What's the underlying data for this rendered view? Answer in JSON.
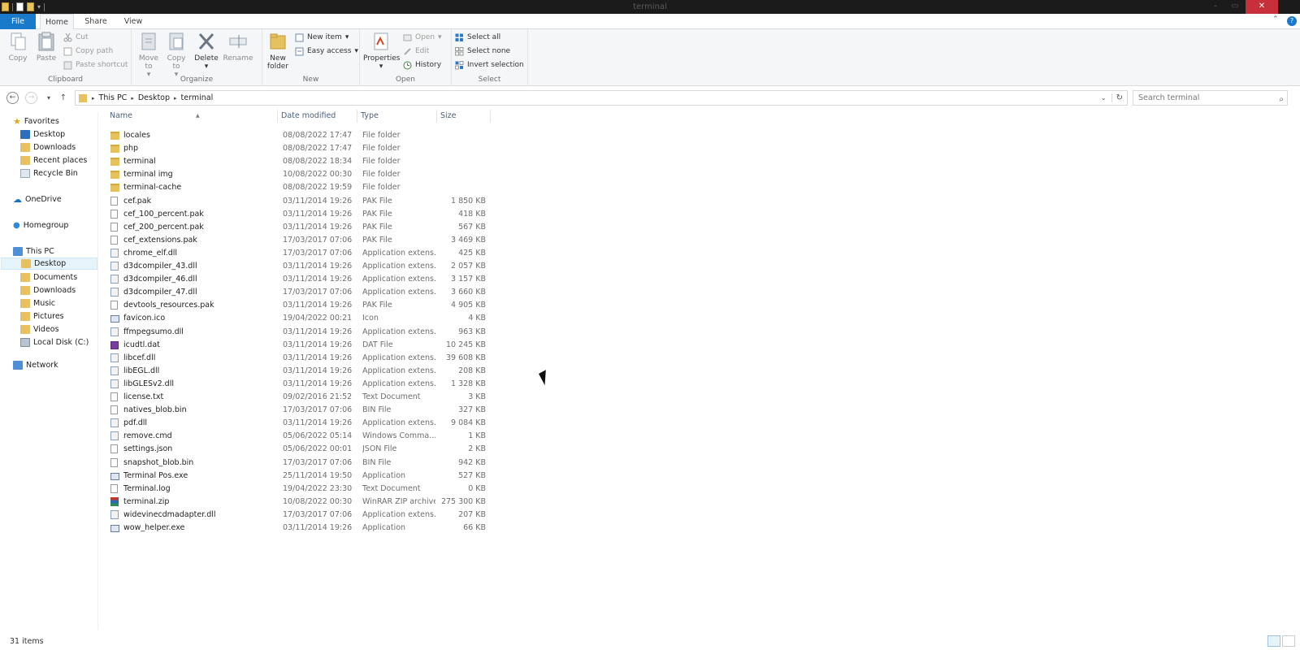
{
  "window": {
    "title": "terminal",
    "close_label": "✕"
  },
  "tabs": [
    {
      "label": "File"
    },
    {
      "label": "Home"
    },
    {
      "label": "Share"
    },
    {
      "label": "View"
    }
  ],
  "ribbon": {
    "clipboard": {
      "label": "Clipboard",
      "copy": "Copy",
      "paste": "Paste",
      "cut": "Cut",
      "copy_path": "Copy path",
      "paste_shortcut": "Paste shortcut"
    },
    "organize": {
      "label": "Organize",
      "move_to": "Move to",
      "copy_to": "Copy to",
      "delete": "Delete",
      "rename": "Rename"
    },
    "new": {
      "label": "New",
      "new_folder": "New folder",
      "new_item": "New item",
      "easy_access": "Easy access"
    },
    "open": {
      "label": "Open",
      "properties": "Properties",
      "open": "Open",
      "edit": "Edit",
      "history": "History"
    },
    "select": {
      "label": "Select",
      "select_all": "Select all",
      "select_none": "Select none",
      "invert_selection": "Invert selection"
    }
  },
  "address": {
    "crumbs": [
      "This PC",
      "Desktop",
      "terminal"
    ],
    "search_placeholder": "Search terminal"
  },
  "nav": {
    "favorites": "Favorites",
    "fav_items": [
      "Desktop",
      "Downloads",
      "Recent places",
      "Recycle Bin"
    ],
    "onedrive": "OneDrive",
    "homegroup": "Homegroup",
    "thispc": "This PC",
    "pc_items": [
      "Desktop",
      "Documents",
      "Downloads",
      "Music",
      "Pictures",
      "Videos",
      "Local Disk (C:)"
    ],
    "network": "Network"
  },
  "columns": {
    "name": "Name",
    "date": "Date modified",
    "type": "Type",
    "size": "Size"
  },
  "files": [
    {
      "name": "locales",
      "date": "08/08/2022 17:47",
      "type": "File folder",
      "size": "",
      "icon": "folder"
    },
    {
      "name": "php",
      "date": "08/08/2022 17:47",
      "type": "File folder",
      "size": "",
      "icon": "folder"
    },
    {
      "name": "terminal",
      "date": "08/08/2022 18:34",
      "type": "File folder",
      "size": "",
      "icon": "folder"
    },
    {
      "name": "terminal img",
      "date": "10/08/2022 00:30",
      "type": "File folder",
      "size": "",
      "icon": "folder"
    },
    {
      "name": "terminal-cache",
      "date": "08/08/2022 19:59",
      "type": "File folder",
      "size": "",
      "icon": "folder"
    },
    {
      "name": "cef.pak",
      "date": "03/11/2014 19:26",
      "type": "PAK File",
      "size": "1 850 KB",
      "icon": "file"
    },
    {
      "name": "cef_100_percent.pak",
      "date": "03/11/2014 19:26",
      "type": "PAK File",
      "size": "418 KB",
      "icon": "file"
    },
    {
      "name": "cef_200_percent.pak",
      "date": "03/11/2014 19:26",
      "type": "PAK File",
      "size": "567 KB",
      "icon": "file"
    },
    {
      "name": "cef_extensions.pak",
      "date": "17/03/2017 07:06",
      "type": "PAK File",
      "size": "3 469 KB",
      "icon": "file"
    },
    {
      "name": "chrome_elf.dll",
      "date": "17/03/2017 07:06",
      "type": "Application extens...",
      "size": "425 KB",
      "icon": "app"
    },
    {
      "name": "d3dcompiler_43.dll",
      "date": "03/11/2014 19:26",
      "type": "Application extens...",
      "size": "2 057 KB",
      "icon": "app"
    },
    {
      "name": "d3dcompiler_46.dll",
      "date": "03/11/2014 19:26",
      "type": "Application extens...",
      "size": "3 157 KB",
      "icon": "app"
    },
    {
      "name": "d3dcompiler_47.dll",
      "date": "17/03/2017 07:06",
      "type": "Application extens...",
      "size": "3 660 KB",
      "icon": "app"
    },
    {
      "name": "devtools_resources.pak",
      "date": "03/11/2014 19:26",
      "type": "PAK File",
      "size": "4 905 KB",
      "icon": "file"
    },
    {
      "name": "favicon.ico",
      "date": "19/04/2022 00:21",
      "type": "Icon",
      "size": "4 KB",
      "icon": "exe"
    },
    {
      "name": "ffmpegsumo.dll",
      "date": "03/11/2014 19:26",
      "type": "Application extens...",
      "size": "963 KB",
      "icon": "app"
    },
    {
      "name": "icudtl.dat",
      "date": "03/11/2014 19:26",
      "type": "DAT File",
      "size": "10 245 KB",
      "icon": "dat"
    },
    {
      "name": "libcef.dll",
      "date": "03/11/2014 19:26",
      "type": "Application extens...",
      "size": "39 608 KB",
      "icon": "app"
    },
    {
      "name": "libEGL.dll",
      "date": "03/11/2014 19:26",
      "type": "Application extens...",
      "size": "208 KB",
      "icon": "app"
    },
    {
      "name": "libGLESv2.dll",
      "date": "03/11/2014 19:26",
      "type": "Application extens...",
      "size": "1 328 KB",
      "icon": "app"
    },
    {
      "name": "license.txt",
      "date": "09/02/2016 21:52",
      "type": "Text Document",
      "size": "3 KB",
      "icon": "file"
    },
    {
      "name": "natives_blob.bin",
      "date": "17/03/2017 07:06",
      "type": "BIN File",
      "size": "327 KB",
      "icon": "file"
    },
    {
      "name": "pdf.dll",
      "date": "03/11/2014 19:26",
      "type": "Application extens...",
      "size": "9 084 KB",
      "icon": "app"
    },
    {
      "name": "remove.cmd",
      "date": "05/06/2022 05:14",
      "type": "Windows Comma...",
      "size": "1 KB",
      "icon": "app"
    },
    {
      "name": "settings.json",
      "date": "05/06/2022 00:01",
      "type": "JSON File",
      "size": "2 KB",
      "icon": "file"
    },
    {
      "name": "snapshot_blob.bin",
      "date": "17/03/2017 07:06",
      "type": "BIN File",
      "size": "942 KB",
      "icon": "file"
    },
    {
      "name": "Terminal Pos.exe",
      "date": "25/11/2014 19:50",
      "type": "Application",
      "size": "527 KB",
      "icon": "exe"
    },
    {
      "name": "Terminal.log",
      "date": "19/04/2022 23:30",
      "type": "Text Document",
      "size": "0 KB",
      "icon": "file"
    },
    {
      "name": "terminal.zip",
      "date": "10/08/2022 00:30",
      "type": "WinRAR ZIP archive",
      "size": "275 300 KB",
      "icon": "zip"
    },
    {
      "name": "widevinecdmadapter.dll",
      "date": "17/03/2017 07:06",
      "type": "Application extens...",
      "size": "207 KB",
      "icon": "app"
    },
    {
      "name": "wow_helper.exe",
      "date": "03/11/2014 19:26",
      "type": "Application",
      "size": "66 KB",
      "icon": "exe"
    }
  ],
  "status": {
    "items": "31 items"
  },
  "colors": {
    "accent": "#1979ca",
    "close": "#c7303a",
    "titlebar": "#1b1b1b",
    "folder": "#e6c15f"
  }
}
